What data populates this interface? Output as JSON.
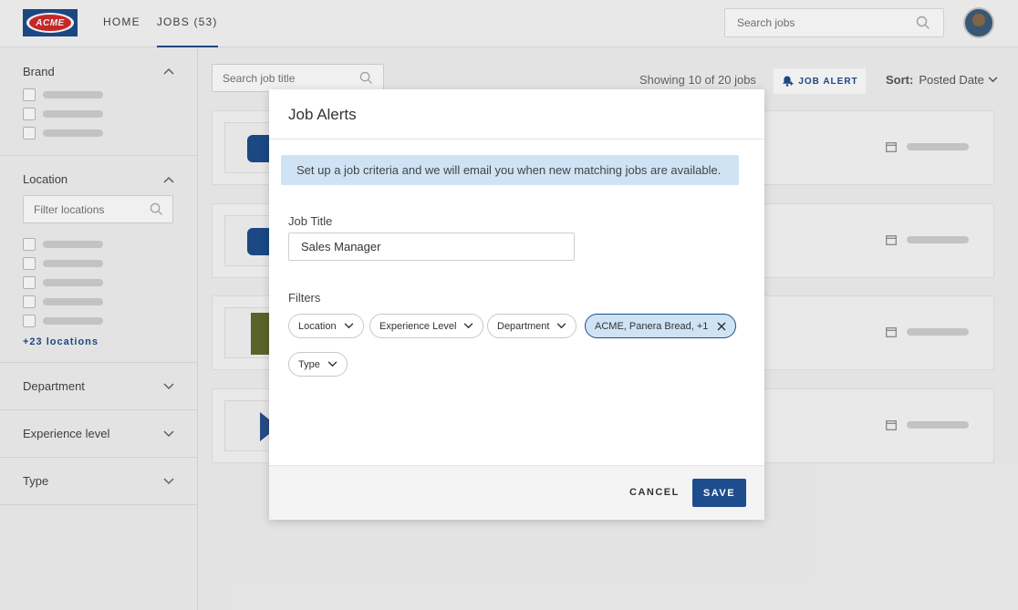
{
  "header": {
    "logo_text": "ACME",
    "nav": [
      {
        "label": "HOME"
      },
      {
        "label": "JOBS (53)"
      }
    ],
    "search_placeholder": "Search jobs"
  },
  "sidebar": {
    "brand_title": "Brand",
    "location_title": "Location",
    "location_filter_placeholder": "Filter locations",
    "more_locations": "+23 locations",
    "department_title": "Department",
    "experience_title": "Experience level",
    "type_title": "Type"
  },
  "main": {
    "title_search_placeholder": "Search job title",
    "showing_text": "Showing 10 of 20 jobs",
    "job_alert_label": "JOB ALERT",
    "sort_label": "Sort:",
    "sort_value": "Posted Date"
  },
  "modal": {
    "title": "Job Alerts",
    "info_text": "Set up a job criteria and we will email you when new matching jobs are available.",
    "job_title_label": "Job Title",
    "job_title_value": "Sales Manager",
    "filters_label": "Filters",
    "filters": {
      "location": "Location",
      "experience": "Experience Level",
      "department": "Department",
      "brand_selected": "ACME, Panera Bread, +1",
      "type": "Type"
    },
    "cancel_label": "CANCEL",
    "save_label": "SAVE"
  },
  "colors": {
    "brand_blue": "#1d4d8c",
    "acme_red": "#d42a2a",
    "info_bg": "#cfe3f5"
  }
}
